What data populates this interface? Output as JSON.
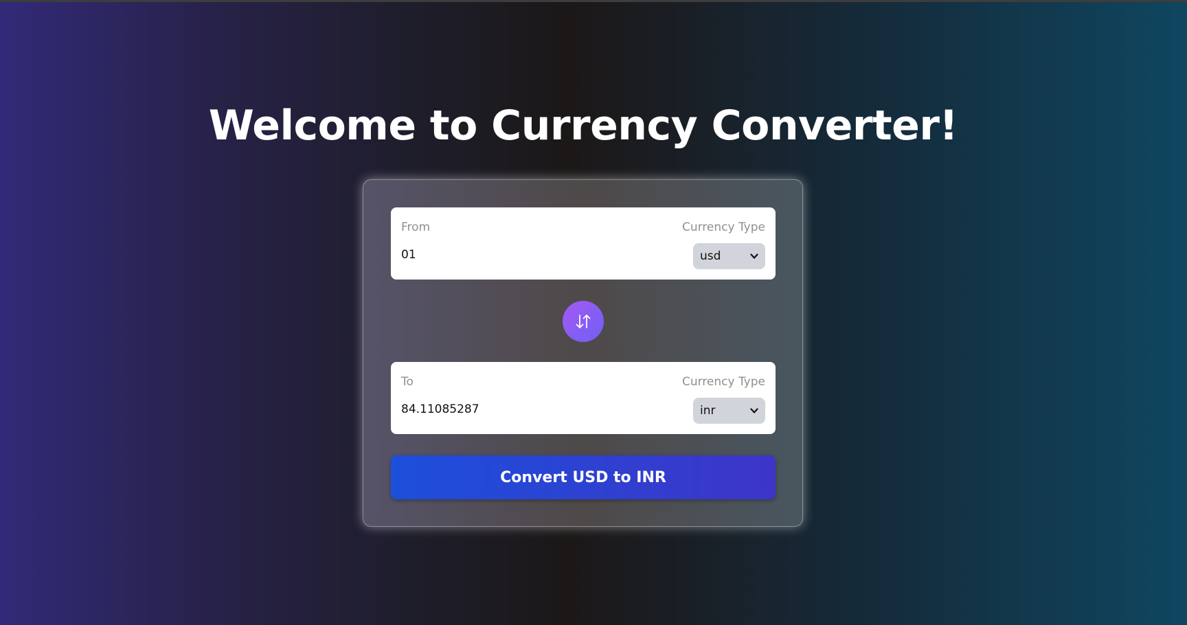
{
  "header": {
    "title": "Welcome to Currency Converter!"
  },
  "from_field": {
    "label": "From",
    "type_label": "Currency Type",
    "amount": "01",
    "currency": "usd"
  },
  "swap": {
    "icon": "swap-arrows-icon"
  },
  "to_field": {
    "label": "To",
    "type_label": "Currency Type",
    "amount": "84.11085287",
    "currency": "inr"
  },
  "convert_button": {
    "label": "Convert USD to INR"
  },
  "colors": {
    "convert_button": "#1c4fdb",
    "swap_button": "#a55af6",
    "select_bg": "#d1d5db"
  }
}
